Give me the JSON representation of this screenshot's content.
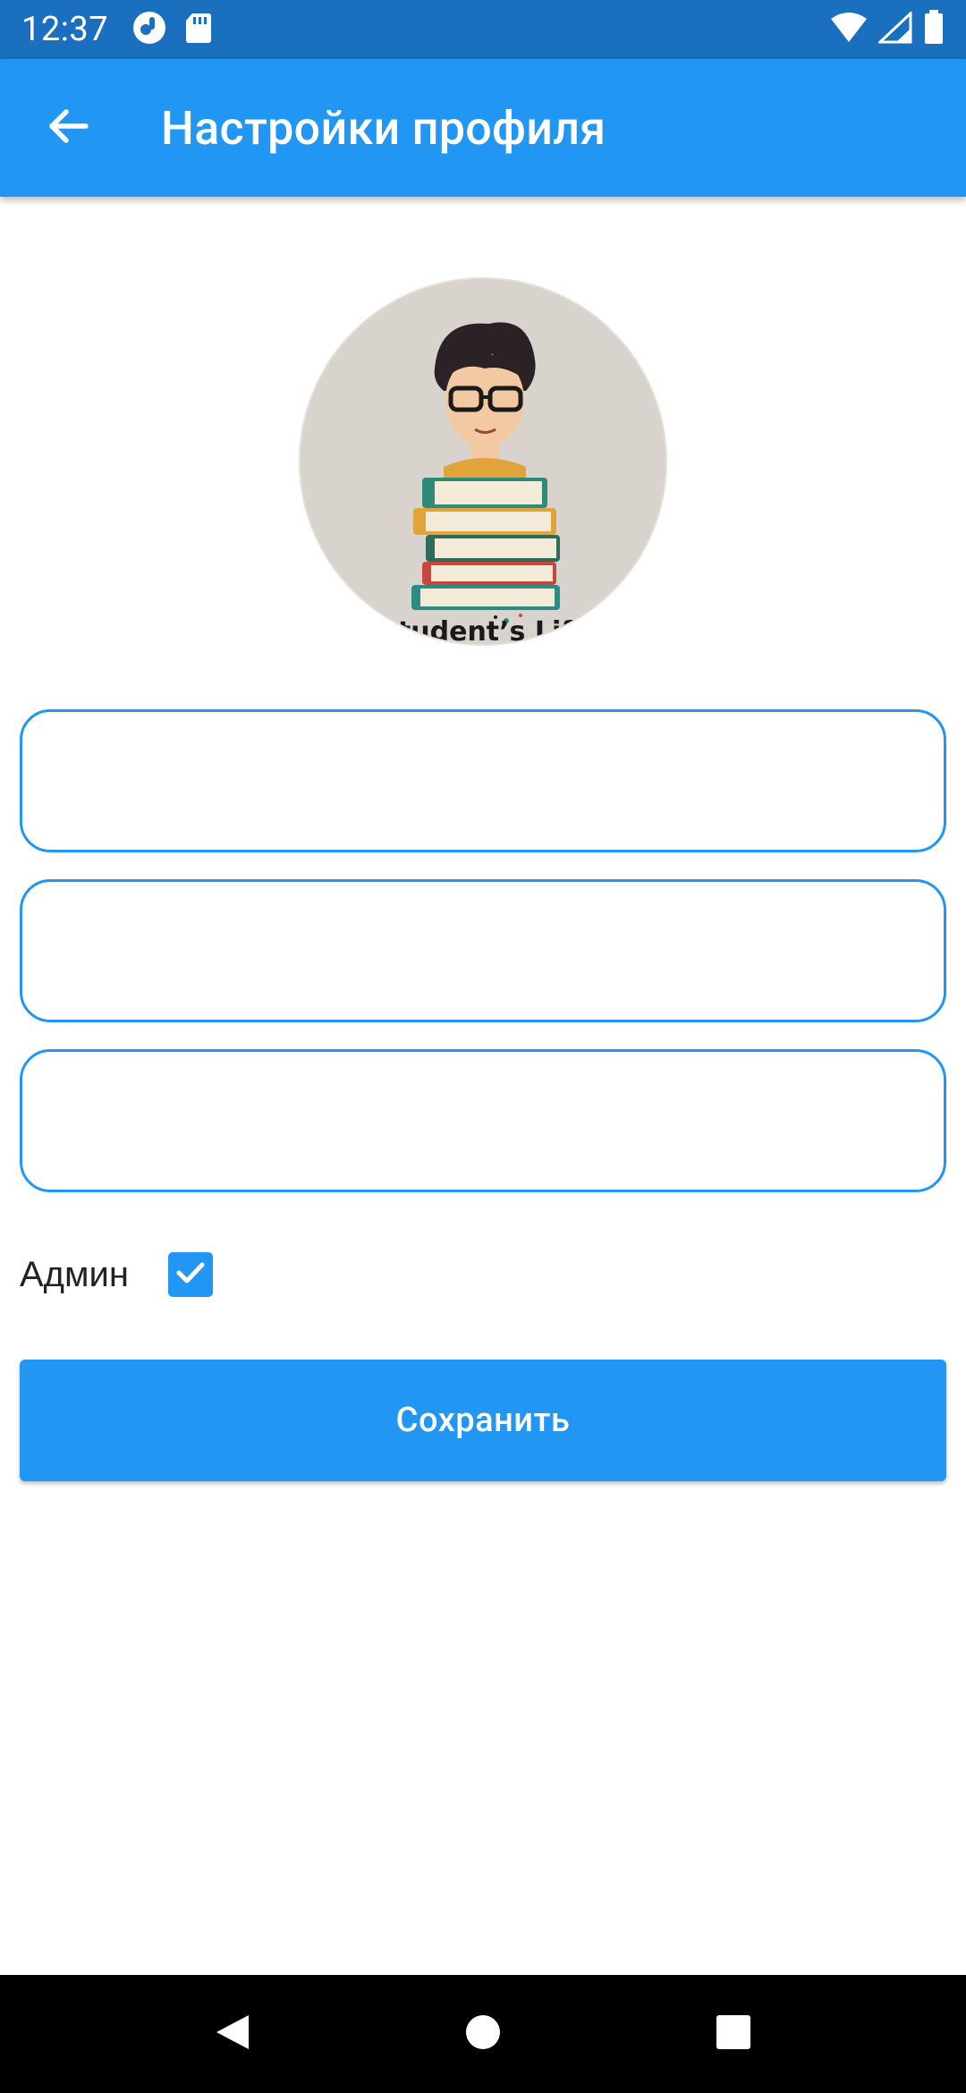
{
  "status_bar": {
    "time": "12:37",
    "icons_left": [
      "notification-circle-icon",
      "sd-card-icon"
    ],
    "icons_right": [
      "wifi-icon",
      "signal-icon",
      "battery-icon"
    ]
  },
  "app_bar": {
    "back_icon": "arrow-left-icon",
    "title": "Настройки профиля",
    "color": "#2196f3"
  },
  "avatar": {
    "logo_text": "Student’s Life"
  },
  "form": {
    "fields": [
      {
        "value": "",
        "placeholder": ""
      },
      {
        "value": "",
        "placeholder": ""
      },
      {
        "value": "",
        "placeholder": ""
      }
    ],
    "admin_label": "Админ",
    "admin_checked": true,
    "save_label": "Сохранить"
  },
  "nav_bar": {
    "icons": [
      "back-triangle-icon",
      "home-circle-icon",
      "recents-square-icon"
    ]
  },
  "colors": {
    "accent": "#2196f3",
    "status_bar": "#1b6fbf",
    "nav_bar": "#000000"
  }
}
